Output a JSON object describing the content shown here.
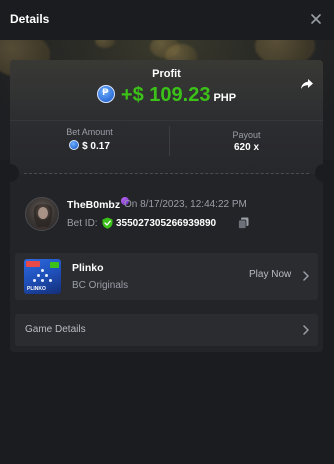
{
  "header": {
    "title": "Details",
    "close_icon": "close-icon"
  },
  "profit": {
    "label": "Profit",
    "coin_symbol": "₱",
    "amount": "+$ 109.23",
    "currency": "PHP",
    "amount_color": "#3bc117",
    "share_icon": "share-icon"
  },
  "stats": {
    "bet_amount_label": "Bet Amount",
    "bet_amount_value": "$ 0.17",
    "payout_label": "Payout",
    "payout_value": "620 x"
  },
  "bet_info": {
    "username": "TheB0mbz",
    "datetime": "On 8/17/2023, 12:44:22 PM",
    "bet_id_label": "Bet ID:",
    "bet_id_value": "355027305266939890"
  },
  "game": {
    "name": "Plinko",
    "provider": "BC Originals",
    "action_label": "Play Now",
    "thumb_text": "PLINKO"
  },
  "game_details": {
    "label": "Game Details"
  }
}
